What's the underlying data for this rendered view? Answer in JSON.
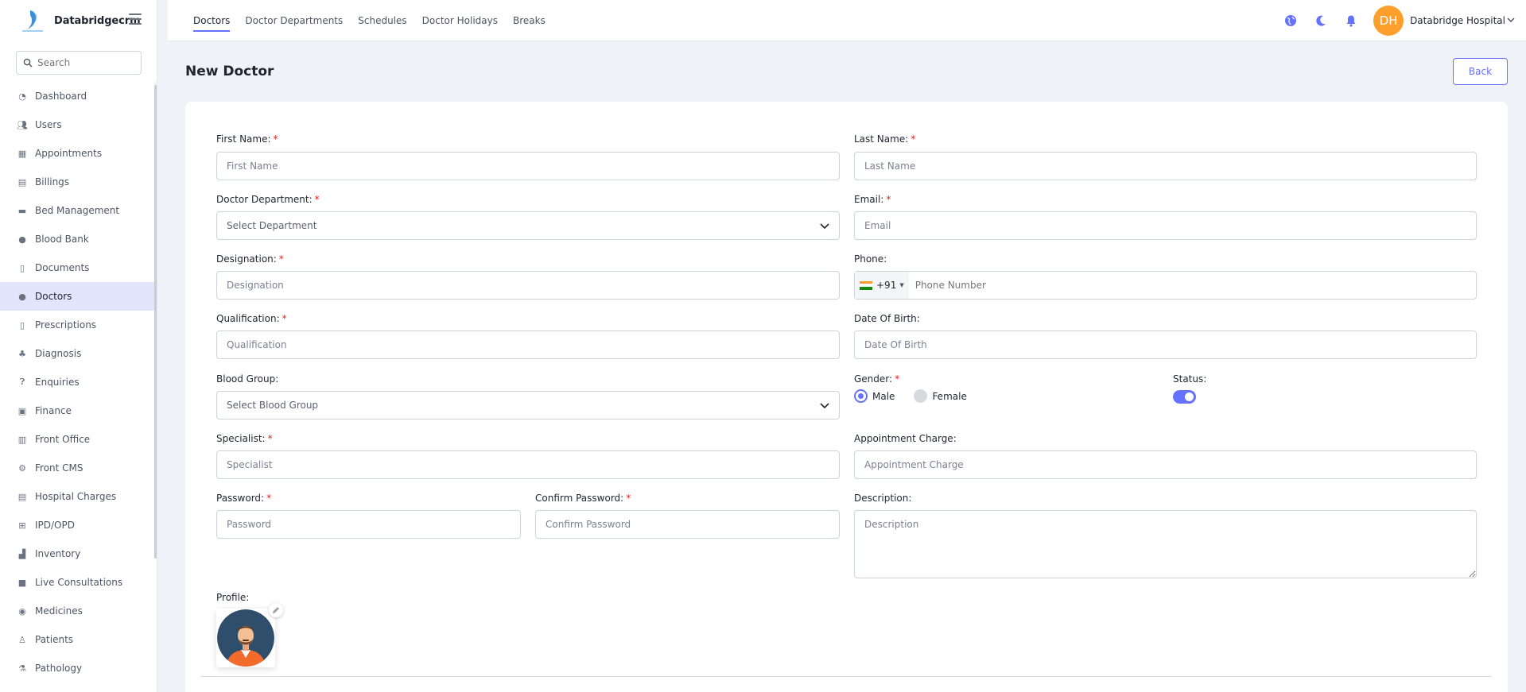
{
  "brand": {
    "name": "Databridgecrm"
  },
  "search": {
    "placeholder": "Search"
  },
  "sidebar": {
    "items": [
      {
        "label": "Dashboard",
        "icon": "dashboard-icon"
      },
      {
        "label": "Users",
        "icon": "users-icon"
      },
      {
        "label": "Appointments",
        "icon": "calendar-icon"
      },
      {
        "label": "Billings",
        "icon": "invoice-icon"
      },
      {
        "label": "Bed Management",
        "icon": "bed-icon"
      },
      {
        "label": "Blood Bank",
        "icon": "blood-drop-icon"
      },
      {
        "label": "Documents",
        "icon": "document-icon"
      },
      {
        "label": "Doctors",
        "icon": "doctor-icon",
        "active": true
      },
      {
        "label": "Prescriptions",
        "icon": "prescription-icon"
      },
      {
        "label": "Diagnosis",
        "icon": "diagnosis-icon"
      },
      {
        "label": "Enquiries",
        "icon": "question-icon"
      },
      {
        "label": "Finance",
        "icon": "money-icon"
      },
      {
        "label": "Front Office",
        "icon": "building-icon"
      },
      {
        "label": "Front CMS",
        "icon": "cog-icon"
      },
      {
        "label": "Hospital Charges",
        "icon": "charges-icon"
      },
      {
        "label": "IPD/OPD",
        "icon": "hospital-icon"
      },
      {
        "label": "Inventory",
        "icon": "dolly-icon"
      },
      {
        "label": "Live Consultations",
        "icon": "video-icon"
      },
      {
        "label": "Medicines",
        "icon": "pills-icon"
      },
      {
        "label": "Patients",
        "icon": "patient-icon"
      },
      {
        "label": "Pathology",
        "icon": "flask-icon"
      }
    ]
  },
  "topbar": {
    "tabs": [
      "Doctors",
      "Doctor Departments",
      "Schedules",
      "Doctor Holidays",
      "Breaks"
    ],
    "active_tab": "Doctors",
    "avatar_initials": "DH",
    "user_name": "Databridge Hospital"
  },
  "page": {
    "title": "New Doctor",
    "back_label": "Back"
  },
  "form": {
    "first_name": {
      "label": "First Name:",
      "placeholder": "First Name"
    },
    "last_name": {
      "label": "Last Name:",
      "placeholder": "Last Name"
    },
    "department": {
      "label": "Doctor Department:",
      "value": "Select Department"
    },
    "email": {
      "label": "Email:",
      "placeholder": "Email"
    },
    "designation": {
      "label": "Designation:",
      "placeholder": "Designation"
    },
    "phone": {
      "label": "Phone:",
      "dial_code": "+91",
      "placeholder": "Phone Number"
    },
    "qualification": {
      "label": "Qualification:",
      "placeholder": "Qualification"
    },
    "dob": {
      "label": "Date Of Birth:",
      "placeholder": "Date Of Birth"
    },
    "blood_group": {
      "label": "Blood Group:",
      "value": "Select Blood Group"
    },
    "gender": {
      "label": "Gender:",
      "male": "Male",
      "female": "Female",
      "selected": "Male"
    },
    "status": {
      "label": "Status:",
      "on": true
    },
    "specialist": {
      "label": "Specialist:",
      "placeholder": "Specialist"
    },
    "appointment_charge": {
      "label": "Appointment Charge:",
      "placeholder": "Appointment Charge"
    },
    "password": {
      "label": "Password:",
      "placeholder": "Password"
    },
    "confirm_password": {
      "label": "Confirm Password:",
      "placeholder": "Confirm Password"
    },
    "description": {
      "label": "Description:",
      "placeholder": "Description"
    },
    "profile": {
      "label": "Profile:"
    },
    "required_mark": "*"
  },
  "colors": {
    "accent": "#6571ff",
    "avatar_bg": "#ff9f2b",
    "required": "#e02020",
    "active_nav_bg": "#e2e5fb"
  }
}
